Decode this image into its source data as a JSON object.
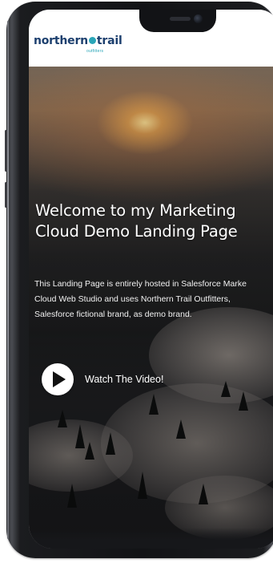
{
  "brand": {
    "name": "northern trail",
    "name_part1": "northern",
    "name_part2": "trail",
    "sub": "outfitters",
    "accent_color": "#2aa6b8",
    "text_color": "#1c3f6e"
  },
  "hero": {
    "title": "Welcome to my Marketing Cloud Demo Landing Page",
    "description_lines": [
      "This Landing Page is entirely hosted in Salesforce Marke",
      "Cloud Web Studio and uses Northern Trail Outfitters,",
      "Salesforce fictional brand, as demo brand."
    ]
  },
  "video": {
    "label": "Watch The Video!",
    "icon": "play-icon"
  }
}
